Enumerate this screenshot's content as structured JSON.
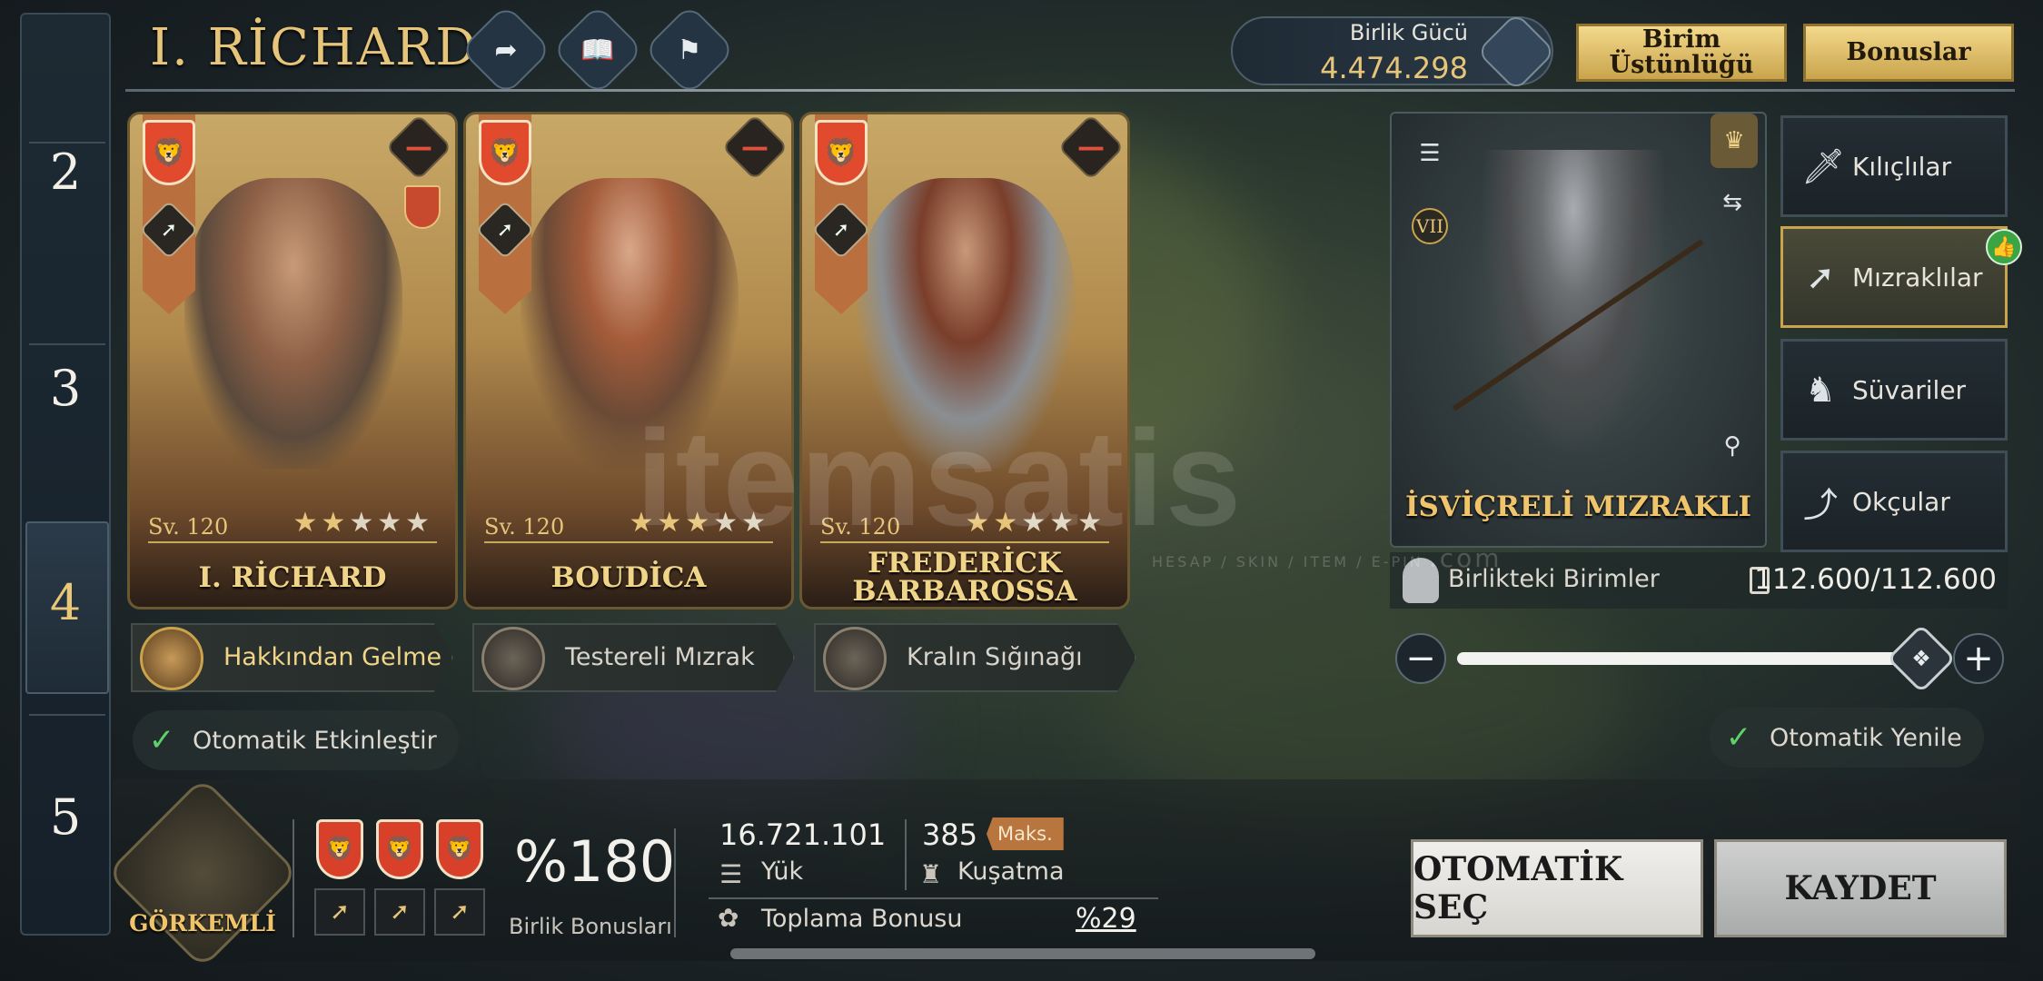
{
  "rail": {
    "numbers": [
      "2",
      "3",
      "4",
      "5"
    ]
  },
  "header": {
    "title": "I. RİCHARD"
  },
  "power": {
    "label": "Birlik Gücü",
    "value": "4.474.298"
  },
  "buttons": {
    "superiority": "Birim Üstünlüğü",
    "bonuses": "Bonuslar",
    "auto_select": "OTOMATİK SEÇ",
    "save": "KAYDET"
  },
  "heroes": [
    {
      "level": "Sv. 120",
      "name": "I. RİCHARD",
      "stars": 2
    },
    {
      "level": "Sv. 120",
      "name": "BOUDİCA",
      "stars": 3
    },
    {
      "level": "Sv. 120",
      "name": "FREDERİCK BARBAROSSA",
      "stars": 2
    }
  ],
  "skills": [
    "Hakkından Gelme",
    "Testereli Mızrak",
    "Kralın Sığınağı"
  ],
  "auto_activate": "Otomatik Etkinleştir",
  "auto_refresh": "Otomatik Yenile",
  "unit": {
    "name": "İSVİÇRELİ MIZRAKLI",
    "tier": "VII",
    "units_label": "Birlikteki Birimler",
    "units_value": "112.600/112.600"
  },
  "unit_types": [
    {
      "label": "Kılıçlılar",
      "icon": "sword-icon"
    },
    {
      "label": "Mızraklılar",
      "icon": "spear-icon",
      "selected": true
    },
    {
      "label": "Süvariler",
      "icon": "horse-icon"
    },
    {
      "label": "Okçular",
      "icon": "bow-icon"
    }
  ],
  "slider": {
    "fill": 1.0
  },
  "bottom": {
    "formation": "GÖRKEMLİ",
    "bonus_pct": "%180",
    "bonus_label": "Birlik Bonusları",
    "load_value": "16.721.101",
    "load_label": "Yük",
    "siege_value": "385",
    "max_badge": "Maks.",
    "siege_label": "Kuşatma",
    "gather_label": "Toplama Bonusu",
    "gather_value": "%29"
  },
  "watermark": {
    "main": "itemsatis",
    "sub": "HESAP / SKIN / ITEM / E-PIN",
    "com": ".com"
  },
  "colors": {
    "gold": "#e6c57a",
    "accent_green": "#5fd06a",
    "shield_red": "#e24a2e",
    "panel_dark": "#1d2a33"
  }
}
